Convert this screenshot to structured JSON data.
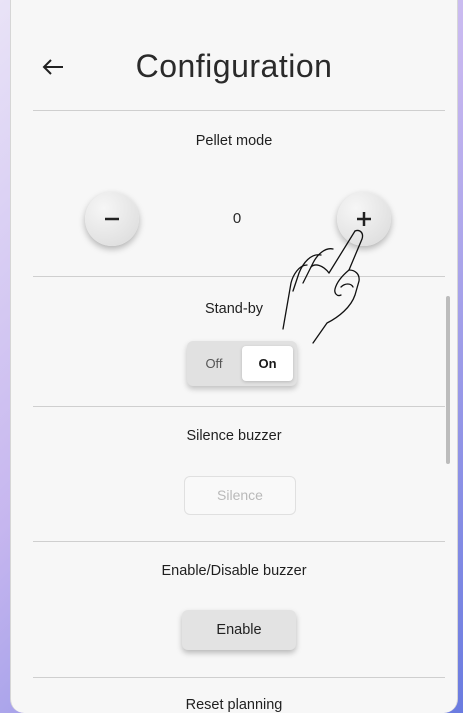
{
  "header": {
    "title": "Configuration",
    "back_icon": "arrow-left-icon"
  },
  "pellet_mode": {
    "label": "Pellet mode",
    "value": "0",
    "decrement_icon": "minus-icon",
    "increment_icon": "plus-icon"
  },
  "standby": {
    "label": "Stand-by",
    "off_label": "Off",
    "on_label": "On",
    "selected": "On"
  },
  "silence_buzzer": {
    "label": "Silence buzzer",
    "button_label": "Silence"
  },
  "buzzer_toggle": {
    "label": "Enable/Disable buzzer",
    "button_label": "Enable"
  },
  "reset_planning": {
    "label": "Reset planning"
  },
  "colors": {
    "panel_bg": "#f7f7f7",
    "divider": "#cfcfcf",
    "disabled_text": "#b9b9b9",
    "gradient_accent": "#6a7be0"
  }
}
